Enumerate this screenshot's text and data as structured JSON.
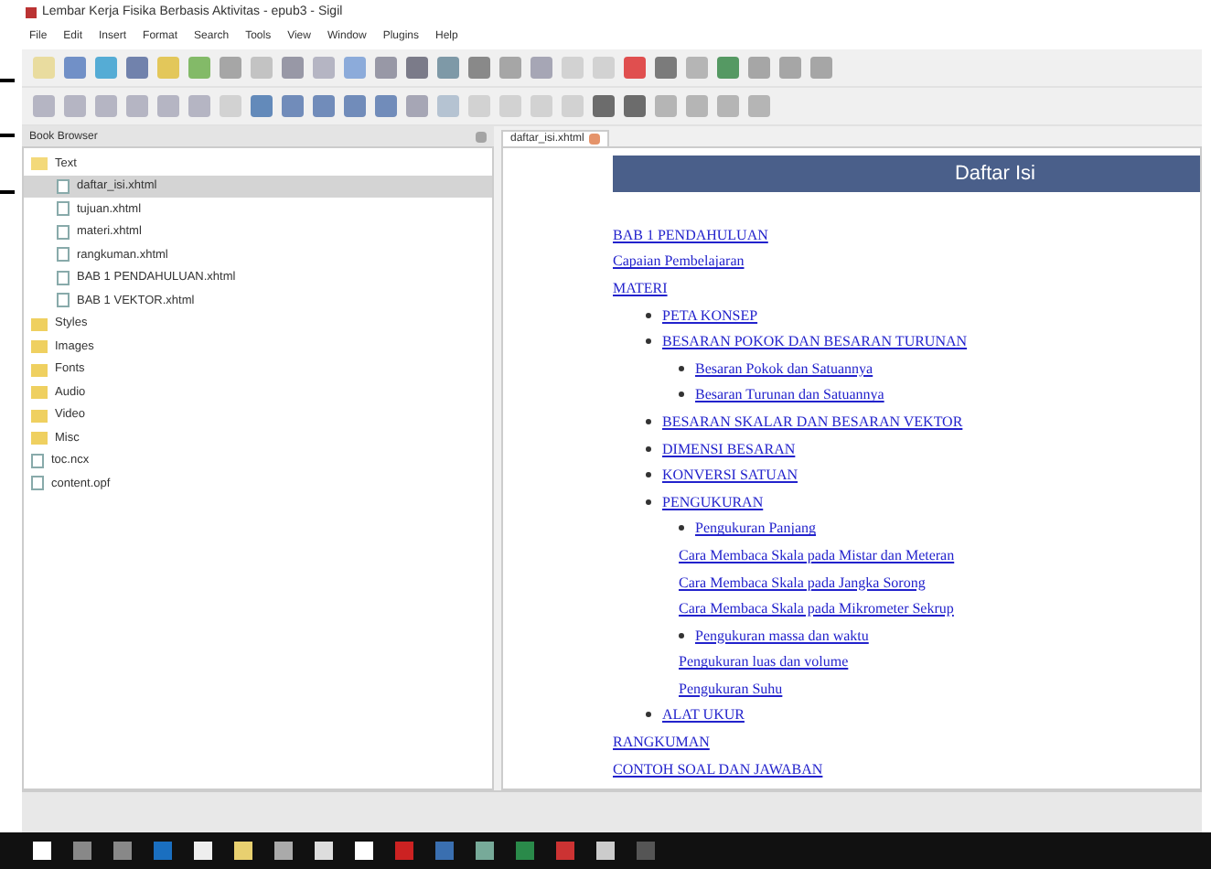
{
  "window": {
    "title": "Lembar Kerja Fisika Berbasis Aktivitas - epub3 - Sigil"
  },
  "menu": [
    "File",
    "Edit",
    "Insert",
    "Format",
    "Search",
    "Tools",
    "View",
    "Window",
    "Plugins",
    "Help"
  ],
  "book_browser": {
    "title": "Book Browser",
    "tree": [
      {
        "label": "Text",
        "kind": "folder",
        "expanded": true,
        "selected": false,
        "children": [
          {
            "label": "daftar_isi.xhtml",
            "kind": "file",
            "selected": true
          },
          {
            "label": "tujuan.xhtml",
            "kind": "file",
            "selected": false
          },
          {
            "label": "materi.xhtml",
            "kind": "file",
            "selected": false
          },
          {
            "label": "rangkuman.xhtml",
            "kind": "file",
            "selected": false
          },
          {
            "label": "BAB 1 PENDAHULUAN.xhtml",
            "kind": "file",
            "selected": false
          },
          {
            "label": "BAB 1 VEKTOR.xhtml",
            "kind": "file",
            "selected": false
          }
        ]
      },
      {
        "label": "Styles",
        "kind": "folder",
        "expanded": false,
        "selected": false
      },
      {
        "label": "Images",
        "kind": "folder",
        "expanded": false,
        "selected": false
      },
      {
        "label": "Fonts",
        "kind": "folder",
        "expanded": false,
        "selected": false
      },
      {
        "label": "Audio",
        "kind": "folder",
        "expanded": false,
        "selected": false
      },
      {
        "label": "Video",
        "kind": "folder",
        "expanded": false,
        "selected": false
      },
      {
        "label": "Misc",
        "kind": "folder",
        "expanded": false,
        "selected": false
      },
      {
        "label": "toc.ncx",
        "kind": "file",
        "selected": false
      },
      {
        "label": "content.opf",
        "kind": "file",
        "selected": false
      }
    ]
  },
  "editor": {
    "tab": "daftar_isi.xhtml",
    "heading": "Daftar Isi",
    "toc": [
      {
        "label": "BAB 1 PENDAHULUAN",
        "bullet": false
      },
      {
        "label": "Capaian Pembelajaran",
        "bullet": false
      },
      {
        "label": "MATERI",
        "bullet": false,
        "children": [
          {
            "label": "PETA KONSEP",
            "bullet": true
          },
          {
            "label": "BESARAN POKOK DAN BESARAN TURUNAN",
            "bullet": true,
            "children": [
              {
                "label": "Besaran Pokok dan Satuannya",
                "bullet": true
              },
              {
                "label": "Besaran Turunan dan Satuannya",
                "bullet": true
              }
            ]
          },
          {
            "label": "BESARAN SKALAR DAN BESARAN VEKTOR",
            "bullet": true
          },
          {
            "label": "DIMENSI BESARAN",
            "bullet": true
          },
          {
            "label": "KONVERSI SATUAN",
            "bullet": true
          },
          {
            "label": "PENGUKURAN",
            "bullet": true,
            "children": [
              {
                "label": "Pengukuran Panjang",
                "bullet": true
              },
              {
                "label": "Cara Membaca Skala pada Mistar dan Meteran",
                "bullet": false
              },
              {
                "label": "Cara Membaca Skala pada Jangka Sorong",
                "bullet": false
              },
              {
                "label": "Cara Membaca Skala pada Mikrometer Sekrup",
                "bullet": false
              },
              {
                "label": "Pengukuran massa dan waktu",
                "bullet": true
              },
              {
                "label": "Pengukuran luas dan volume",
                "bullet": false
              },
              {
                "label": "Pengukuran Suhu",
                "bullet": false
              }
            ]
          },
          {
            "label": "ALAT UKUR",
            "bullet": true
          }
        ]
      },
      {
        "label": "RANGKUMAN",
        "bullet": false
      },
      {
        "label": "CONTOH SOAL DAN JAWABAN",
        "bullet": false
      }
    ]
  }
}
